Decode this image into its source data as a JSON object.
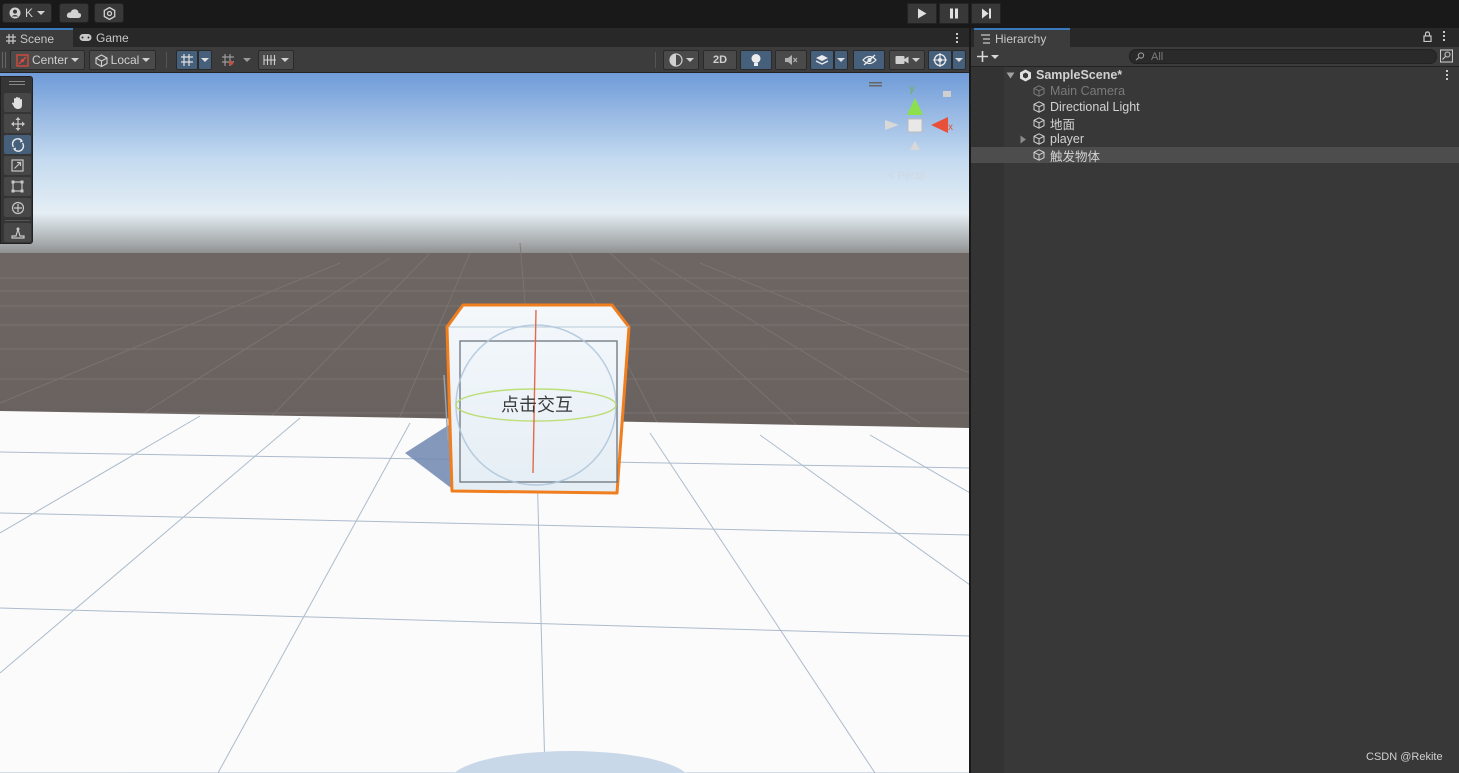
{
  "topbar": {
    "account_label": "K",
    "cloud_icon": "cloud-icon",
    "settings_icon": "gear-icon"
  },
  "scene_tabs": [
    {
      "label": "Scene",
      "icon": "grid-icon",
      "active": true
    },
    {
      "label": "Game",
      "icon": "gamepad-icon",
      "active": false
    }
  ],
  "scene_toolbar": {
    "pivot_label": "Center",
    "space_label": "Local",
    "two_d_label": "2D"
  },
  "viewport": {
    "cube_text": "点击交互",
    "gizmo_y": "y",
    "gizmo_x": "x",
    "persp_label": "< Persp"
  },
  "hierarchy": {
    "tab_label": "Hierarchy",
    "search_placeholder": "All",
    "scene_name": "SampleScene*",
    "items": [
      {
        "label": "Main Camera",
        "dimmed": true
      },
      {
        "label": "Directional Light",
        "dimmed": false
      },
      {
        "label": "地面",
        "dimmed": false
      },
      {
        "label": "player",
        "dimmed": false,
        "has_children": true
      },
      {
        "label": "触发物体",
        "dimmed": false,
        "selected": true
      }
    ]
  },
  "watermark": "CSDN @Rekite",
  "colors": {
    "accent": "#3a79bb",
    "selection_outline": "#f07e1f",
    "panel_bg": "#383838"
  }
}
